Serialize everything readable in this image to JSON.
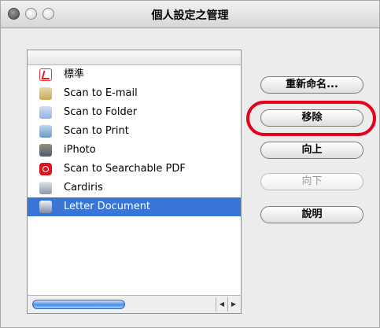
{
  "window": {
    "title": "個人設定之管理"
  },
  "list": {
    "items": [
      {
        "label": "標準",
        "icon": "acrobat-icon",
        "selected": false
      },
      {
        "label": "Scan to E-mail",
        "icon": "mail-icon",
        "selected": false
      },
      {
        "label": "Scan to Folder",
        "icon": "folder-icon",
        "selected": false
      },
      {
        "label": "Scan to Print",
        "icon": "printer-icon",
        "selected": false
      },
      {
        "label": "iPhoto",
        "icon": "iphoto-icon",
        "selected": false
      },
      {
        "label": "Scan to Searchable PDF",
        "icon": "pdf-icon",
        "selected": false
      },
      {
        "label": "Cardiris",
        "icon": "cardiris-icon",
        "selected": false
      },
      {
        "label": "Letter Document",
        "icon": "letter-document-icon",
        "selected": true
      }
    ]
  },
  "buttons": {
    "rename": "重新命名...",
    "remove": "移除",
    "move_up": "向上",
    "move_down": "向下",
    "help": "說明"
  },
  "colors": {
    "selection": "#3875d7",
    "highlight_ring": "#e3001b"
  }
}
